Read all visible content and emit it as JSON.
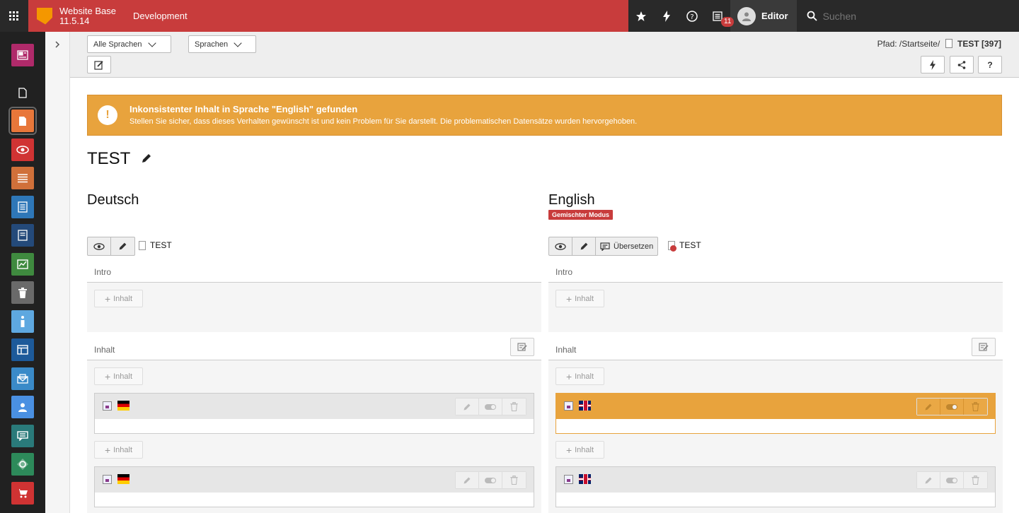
{
  "topbar": {
    "site_name": "Website Base",
    "version": "11.5.14",
    "context": "Development",
    "notification_count": "11",
    "user_name": "Editor",
    "search_placeholder": "Suchen"
  },
  "docheader": {
    "language_select": "Alle Sprachen",
    "view_select": "Sprachen",
    "path_label": "Pfad: /Startseite/",
    "path_page": "TEST [397]"
  },
  "alert": {
    "title": "Inkonsistenter Inhalt in Sprache \"English\" gefunden",
    "message": "Stellen Sie sicher, dass dieses Verhalten gewünscht ist und kein Problem für Sie darstellt. Die problematischen Datensätze wurden hervorgehoben.",
    "color": "#e8a33d"
  },
  "page_title": "TEST",
  "columns": [
    {
      "language": "Deutsch",
      "page_label": "TEST",
      "intro_label": "Intro",
      "content_label": "Inhalt",
      "add_label": "Inhalt",
      "flag": "de"
    },
    {
      "language": "English",
      "mode_badge": "Gemischter Modus",
      "translate_label": "Übersetzen",
      "page_label": "TEST",
      "intro_label": "Intro",
      "content_label": "Inhalt",
      "add_label": "Inhalt",
      "flag": "en"
    }
  ],
  "colors": {
    "brand": "#c83c3c",
    "warning": "#e8a33d",
    "logo": "#f49700"
  }
}
